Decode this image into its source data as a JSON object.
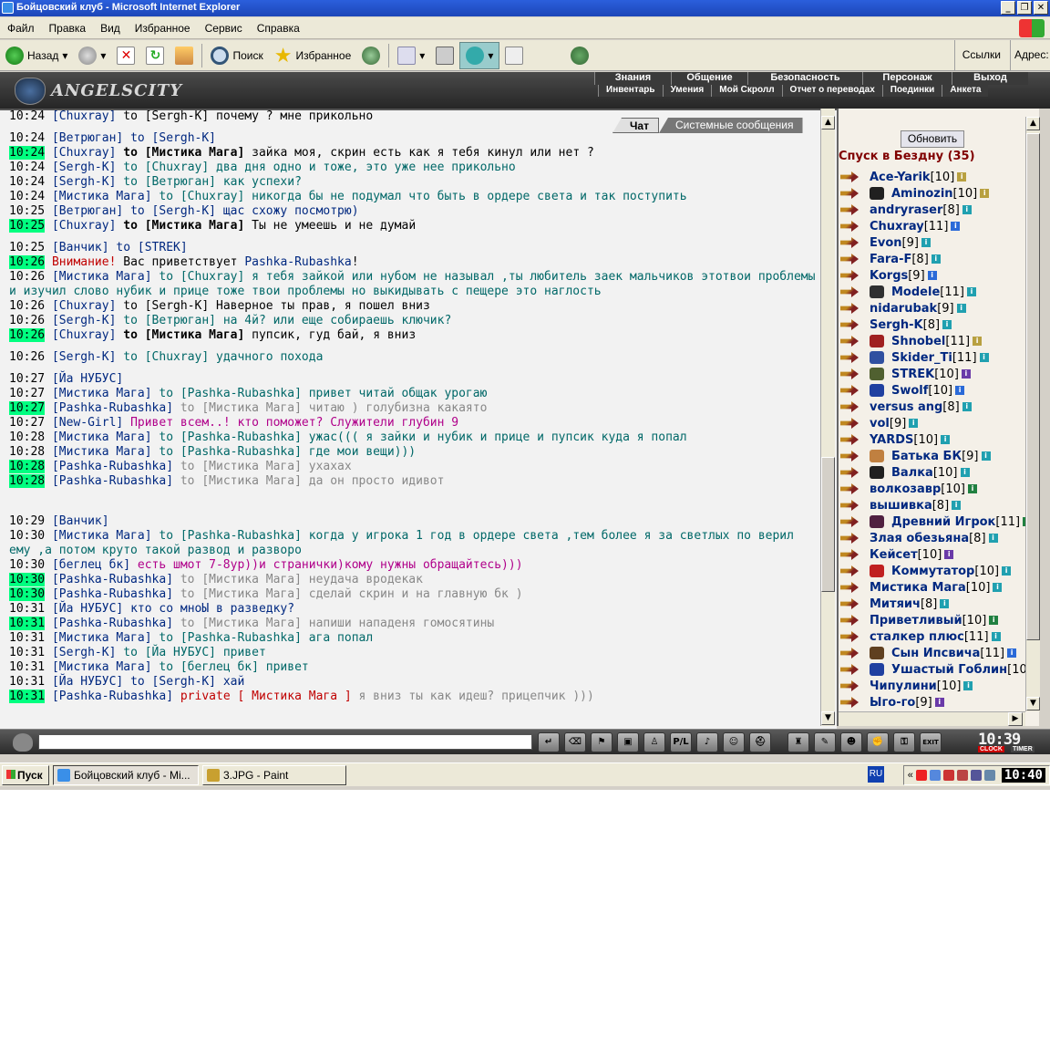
{
  "window": {
    "title": "Бойцовский клуб - Microsoft Internet Explorer"
  },
  "menu": [
    "Файл",
    "Правка",
    "Вид",
    "Избранное",
    "Сервис",
    "Справка"
  ],
  "toolbar": {
    "back": "Назад",
    "search": "Поиск",
    "favorites": "Избранное",
    "links": "Ссылки",
    "address": "Адрес:"
  },
  "game": {
    "logo": "ANGELSCITY",
    "nav_top": [
      "Знания",
      "Общение",
      "Безопасность",
      "Персонаж",
      "Выход"
    ],
    "nav_bottom": [
      "Инвентарь",
      "Умения",
      "Мой Скролл",
      "Отчет о переводах",
      "Поединки",
      "Анкета"
    ]
  },
  "chat": {
    "tab_chat": "Чат",
    "tab_system": "Системные сообщения",
    "lines": [
      {
        "t": "10:24",
        "hl": false,
        "parts": [
          {
            "c": "nk",
            "x": "[Chuxray]"
          },
          {
            "c": "",
            "x": " to [Sergh-K] почему ? мне прикольно"
          }
        ]
      },
      {
        "t": "10:24",
        "hl": false,
        "gap": true,
        "parts": [
          {
            "c": "nk",
            "x": "[Ветрюган]"
          },
          {
            "c": "nk",
            "x": " to [Sergh-K]"
          }
        ]
      },
      {
        "t": "10:24",
        "hl": true,
        "parts": [
          {
            "c": "nk",
            "x": "[Chuxray]"
          },
          {
            "c": "bo",
            "x": " to [Мистика Мага]"
          },
          {
            "c": "",
            "x": " зайка моя, скрин есть как я тебя кинул или нет ?"
          }
        ]
      },
      {
        "t": "10:24",
        "hl": false,
        "parts": [
          {
            "c": "nk",
            "x": "[Sergh-K]"
          },
          {
            "c": "mc",
            "x": " to [Chuxray] два дня одно и тоже, это уже нее прикольно"
          }
        ]
      },
      {
        "t": "10:24",
        "hl": false,
        "parts": [
          {
            "c": "nk",
            "x": "[Sergh-K]"
          },
          {
            "c": "mc",
            "x": " to [Ветрюган] как успехи?"
          }
        ]
      },
      {
        "t": "10:24",
        "hl": false,
        "parts": [
          {
            "c": "nk",
            "x": "[Мистика Мага]"
          },
          {
            "c": "mc",
            "x": " to [Chuxray] никогда бы не подумал что быть в ордере света и так поступить"
          }
        ]
      },
      {
        "t": "10:25",
        "hl": false,
        "parts": [
          {
            "c": "nk",
            "x": "[Ветрюган]"
          },
          {
            "c": "nk",
            "x": " to [Sergh-K] щас схожу посмотрю)"
          }
        ]
      },
      {
        "t": "10:25",
        "hl": true,
        "parts": [
          {
            "c": "nk",
            "x": "[Chuxray]"
          },
          {
            "c": "bo",
            "x": " to [Мистика Мага]"
          },
          {
            "c": "",
            "x": " Ты не умеешь и не думай"
          }
        ]
      },
      {
        "t": "10:25",
        "hl": false,
        "gap": true,
        "parts": [
          {
            "c": "nk",
            "x": "[Ванчик]"
          },
          {
            "c": "nk",
            "x": " to [STREK]"
          }
        ]
      },
      {
        "t": "10:26",
        "hl": true,
        "parts": [
          {
            "c": "wr",
            "x": "Внимание!"
          },
          {
            "c": "",
            "x": " Вас приветствует "
          },
          {
            "c": "nk",
            "x": "Pashka-Rubashka"
          },
          {
            "c": "",
            "x": "!"
          }
        ]
      },
      {
        "t": "10:26",
        "hl": false,
        "wrap": true,
        "parts": [
          {
            "c": "nk",
            "x": "[Мистика Мага]"
          },
          {
            "c": "mc",
            "x": " to [Chuxray] я тебя зайкой или нубом не называл ,ты любитель заек мальчиков этотвои проблемы и изучил слово нубик и прице тоже твои проблемы но выкидывать с пещере это наглость"
          }
        ]
      },
      {
        "t": "10:26",
        "hl": false,
        "parts": [
          {
            "c": "nk",
            "x": "[Chuxray]"
          },
          {
            "c": "",
            "x": " to [Sergh-K] Наверное ты прав, я пошел вниз"
          }
        ]
      },
      {
        "t": "10:26",
        "hl": false,
        "parts": [
          {
            "c": "nk",
            "x": "[Sergh-K]"
          },
          {
            "c": "mc",
            "x": " to [Ветрюган] на 4й? или еще собираешь ключик?"
          }
        ]
      },
      {
        "t": "10:26",
        "hl": true,
        "parts": [
          {
            "c": "nk",
            "x": "[Chuxray]"
          },
          {
            "c": "bo",
            "x": " to [Мистика Мага]"
          },
          {
            "c": "",
            "x": " пупсик, гуд бай, я вниз"
          }
        ]
      },
      {
        "t": "10:26",
        "hl": false,
        "gap": true,
        "parts": [
          {
            "c": "nk",
            "x": "[Sergh-K]"
          },
          {
            "c": "mc",
            "x": " to [Chuxray]"
          },
          {
            "c": "mc",
            "x": "        удачного похода"
          }
        ]
      },
      {
        "t": "10:27",
        "hl": false,
        "gap": true,
        "parts": [
          {
            "c": "nk",
            "x": "[Йа НУБУС]"
          }
        ]
      },
      {
        "t": "10:27",
        "hl": false,
        "parts": [
          {
            "c": "nk",
            "x": "[Мистика Мага]"
          },
          {
            "c": "mc",
            "x": " to [Pashka-Rubashka] привет читай общак урогаю"
          }
        ]
      },
      {
        "t": "10:27",
        "hl": true,
        "parts": [
          {
            "c": "nk",
            "x": "[Pashka-Rubashka]"
          },
          {
            "c": "gr",
            "x": " to [Мистика Мага] читаю ) голубизна какаято"
          }
        ]
      },
      {
        "t": "10:27",
        "hl": false,
        "parts": [
          {
            "c": "nk",
            "x": "[New-Girl]"
          },
          {
            "c": "pr",
            "x": " Привет всем..! кто поможет? Служители глубин 9"
          }
        ]
      },
      {
        "t": "10:28",
        "hl": false,
        "parts": [
          {
            "c": "nk",
            "x": "[Мистика Мага]"
          },
          {
            "c": "mc",
            "x": " to [Pashka-Rubashka] ужас((( я зайки и нубик и прице и пупсик куда я попал"
          }
        ]
      },
      {
        "t": "10:28",
        "hl": false,
        "parts": [
          {
            "c": "nk",
            "x": "[Мистика Мага]"
          },
          {
            "c": "mc",
            "x": " to [Pashka-Rubashka] где мои вещи)))"
          }
        ]
      },
      {
        "t": "10:28",
        "hl": true,
        "parts": [
          {
            "c": "nk",
            "x": "[Pashka-Rubashka]"
          },
          {
            "c": "gr",
            "x": " to [Мистика Мага] ухахах"
          }
        ]
      },
      {
        "t": "10:28",
        "hl": true,
        "parts": [
          {
            "c": "nk",
            "x": "[Pashka-Rubashka]"
          },
          {
            "c": "gr",
            "x": " to [Мистика Мага] да он просто идивот"
          }
        ]
      },
      {
        "t": "10:29",
        "hl": false,
        "gap2": true,
        "parts": [
          {
            "c": "nk",
            "x": "[Ванчик]"
          }
        ]
      },
      {
        "t": "10:30",
        "hl": false,
        "wrap": true,
        "parts": [
          {
            "c": "nk",
            "x": "[Мистика Мага]"
          },
          {
            "c": "mc",
            "x": " to [Pashka-Rubashka] когда у игрока 1 год в ордере света ,тем более я за светлых по верил ему ,а потом круто такой развод и разворо"
          }
        ]
      },
      {
        "t": "10:30",
        "hl": false,
        "parts": [
          {
            "c": "nk",
            "x": "[беглец бк]"
          },
          {
            "c": "pr",
            "x": " есть шмот 7-8ур))и странички)кому нужны обращайтесь)))"
          }
        ]
      },
      {
        "t": "10:30",
        "hl": true,
        "parts": [
          {
            "c": "nk",
            "x": "[Pashka-Rubashka]"
          },
          {
            "c": "gr",
            "x": " to [Мистика Мага] неудача вродекак"
          }
        ]
      },
      {
        "t": "10:30",
        "hl": true,
        "parts": [
          {
            "c": "nk",
            "x": "[Pashka-Rubashka]"
          },
          {
            "c": "gr",
            "x": " to [Мистика Мага] сделай скрин и на главную бк )"
          }
        ]
      },
      {
        "t": "10:31",
        "hl": false,
        "parts": [
          {
            "c": "nk",
            "x": "[Йа НУБУС]"
          },
          {
            "c": "nk",
            "x": " кто со мноЫ в разведку?"
          }
        ]
      },
      {
        "t": "10:31",
        "hl": true,
        "parts": [
          {
            "c": "nk",
            "x": "[Pashka-Rubashka]"
          },
          {
            "c": "gr",
            "x": " to [Мистика Мага] напиши нападеня гомосятины"
          }
        ]
      },
      {
        "t": "10:31",
        "hl": false,
        "parts": [
          {
            "c": "nk",
            "x": "[Мистика Мага]"
          },
          {
            "c": "mc",
            "x": " to [Pashka-Rubashka] ага попал"
          }
        ]
      },
      {
        "t": "10:31",
        "hl": false,
        "parts": [
          {
            "c": "nk",
            "x": "[Sergh-K]"
          },
          {
            "c": "mc",
            "x": " to [Йа НУБУС] привет"
          }
        ]
      },
      {
        "t": "10:31",
        "hl": false,
        "parts": [
          {
            "c": "nk",
            "x": "[Мистика Мага]"
          },
          {
            "c": "mc",
            "x": " to [беглец бк] привет"
          }
        ]
      },
      {
        "t": "10:31",
        "hl": false,
        "parts": [
          {
            "c": "nk",
            "x": "[Йа НУБУС]"
          },
          {
            "c": "nk",
            "x": " to [Sergh-K] хай"
          }
        ]
      },
      {
        "t": "10:31",
        "hl": true,
        "parts": [
          {
            "c": "nk",
            "x": "[Pashka-Rubashka]"
          },
          {
            "c": "wr",
            "x": " private [ Мистика Мага ]"
          },
          {
            "c": "gr",
            "x": " я вниз ты как идеш? прицепчик )))"
          }
        ]
      }
    ]
  },
  "roster": {
    "refresh": "Обновить",
    "heading": "Спуск в Бездну (35)",
    "users": [
      {
        "n": "Ace-Yarik",
        "l": "[10]",
        "i": "y"
      },
      {
        "n": "Aminozin",
        "l": "[10]",
        "i": "y",
        "clan": "#202020"
      },
      {
        "n": "andryraser",
        "l": "[8]",
        "i": "c"
      },
      {
        "n": "Chuxray",
        "l": "[11]",
        "i": ""
      },
      {
        "n": "Evon",
        "l": "[9]",
        "i": "c"
      },
      {
        "n": "Fara-F",
        "l": "[8]",
        "i": "c"
      },
      {
        "n": "Korgs",
        "l": "[9]",
        "i": ""
      },
      {
        "n": "Modele",
        "l": "[11]",
        "i": "c",
        "clan": "#303030"
      },
      {
        "n": "nidarubak",
        "l": "[9]",
        "i": "c"
      },
      {
        "n": "Sergh-K",
        "l": "[8]",
        "i": "c"
      },
      {
        "n": "Shnobel",
        "l": "[11]",
        "i": "y",
        "clan": "#a02020"
      },
      {
        "n": "Skider_Ti",
        "l": "[11]",
        "i": "c",
        "clan": "#3050a0"
      },
      {
        "n": "STREK",
        "l": "[10]",
        "i": "v",
        "clan": "#506030"
      },
      {
        "n": "Swolf",
        "l": "[10]",
        "i": "",
        "clan": "#2040a0"
      },
      {
        "n": "versus ang",
        "l": "[8]",
        "i": "c"
      },
      {
        "n": "vol",
        "l": "[9]",
        "i": "c"
      },
      {
        "n": "YARDS",
        "l": "[10]",
        "i": "c"
      },
      {
        "n": "Батька БК",
        "l": "[9]",
        "i": "c",
        "clan": "#c08040"
      },
      {
        "n": "Валка",
        "l": "[10]",
        "i": "c",
        "clan": "#202020"
      },
      {
        "n": "волкозавр",
        "l": "[10]",
        "i": "g"
      },
      {
        "n": "вышивка",
        "l": "[8]",
        "i": "c"
      },
      {
        "n": "Древний Игрок",
        "l": "[11]",
        "i": "g",
        "clan": "#502040"
      },
      {
        "n": "Злая обезьяна",
        "l": "[8]",
        "i": "c"
      },
      {
        "n": "Кейсет",
        "l": "[10]",
        "i": "v"
      },
      {
        "n": "Коммутатор",
        "l": "[10]",
        "i": "c",
        "clan": "#c02020"
      },
      {
        "n": "Мистика Мага",
        "l": "[10]",
        "i": "c"
      },
      {
        "n": "Митяич",
        "l": "[8]",
        "i": "c"
      },
      {
        "n": "Приветливый",
        "l": "[10]",
        "i": "g"
      },
      {
        "n": "сталкер плюс",
        "l": "[11]",
        "i": "c"
      },
      {
        "n": "Сын Ипсвича",
        "l": "[11]",
        "i": "",
        "clan": "#604020"
      },
      {
        "n": "Ушастый Гоблин",
        "l": "[10",
        "i": "none",
        "clan": "#2040a0"
      },
      {
        "n": "Чипулини",
        "l": "[10]",
        "i": "c"
      },
      {
        "n": "Ыго-го",
        "l": "[9]",
        "i": "v"
      }
    ]
  },
  "bottom": {
    "clock": "10:39",
    "clock_label": "CLOCK",
    "timer_label": "TIMER",
    "exit_label": "EXIT"
  },
  "taskbar": {
    "start": "Пуск",
    "task1": "Бойцовский клуб - Mi...",
    "task2": "3.JPG - Paint",
    "lang": "RU",
    "time": "10:40"
  }
}
